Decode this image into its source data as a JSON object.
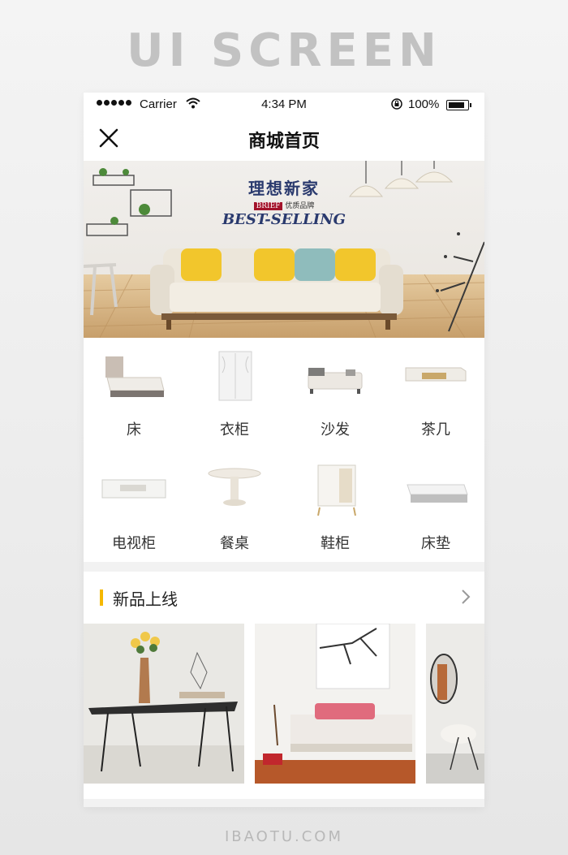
{
  "page": {
    "heading": "UI SCREEN",
    "footer": "IBAOTU.COM"
  },
  "status_bar": {
    "carrier": "Carrier",
    "time": "4:34 PM",
    "battery": "100%"
  },
  "nav": {
    "title": "商城首页",
    "close_icon": "close-icon"
  },
  "banner": {
    "headline": "理想新家",
    "brand": "BRIEF",
    "brand_sub": "优质品牌",
    "tagline": "BEST-SELLING"
  },
  "categories": [
    {
      "label": "床",
      "icon": "bed-icon"
    },
    {
      "label": "衣柜",
      "icon": "wardrobe-icon"
    },
    {
      "label": "沙发",
      "icon": "sofa-icon"
    },
    {
      "label": "茶几",
      "icon": "coffee-table-icon"
    },
    {
      "label": "电视柜",
      "icon": "tv-cabinet-icon"
    },
    {
      "label": "餐桌",
      "icon": "dining-table-icon"
    },
    {
      "label": "鞋柜",
      "icon": "shoe-cabinet-icon"
    },
    {
      "label": "床垫",
      "icon": "mattress-icon"
    }
  ],
  "new_arrivals": {
    "title": "新品上线",
    "accent_color": "#f5b800"
  },
  "colors": {
    "cushion_yellow": "#f2c62c",
    "cushion_teal": "#8fbcbc",
    "floor_wood": "#d9b98a",
    "text_dark": "#222222"
  }
}
